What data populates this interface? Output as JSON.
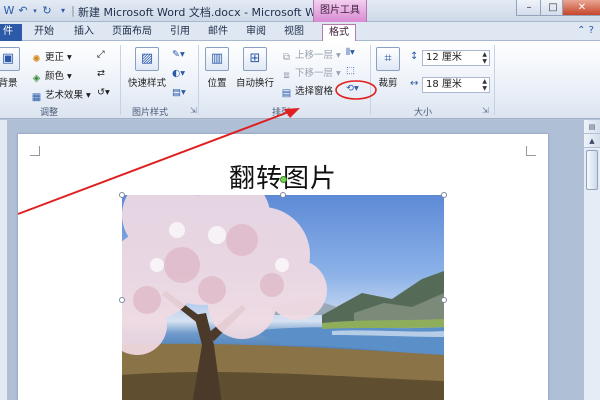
{
  "titlebar": {
    "title": "新建 Microsoft Word 文档.docx - Microsoft W...",
    "context_tab_group": "图片工具",
    "minimize": "–",
    "restore": "□",
    "close": "✕"
  },
  "tabs": {
    "file": "件",
    "home": "开始",
    "insert": "插入",
    "page_layout": "页面布局",
    "references": "引用",
    "mailings": "邮件",
    "review": "审阅",
    "view": "视图",
    "format": "格式"
  },
  "ribbon": {
    "adjust": {
      "remove_bg": "背景",
      "corrections": "更正",
      "color": "颜色",
      "artistic": "艺术效果",
      "label": "调整"
    },
    "picture_styles": {
      "quick_styles": "快速样式",
      "label": "图片样式"
    },
    "arrange": {
      "position": "位置",
      "wrap_text": "自动换行",
      "bring_forward": "上移一层",
      "send_backward": "下移一层",
      "selection_pane": "选择窗格",
      "label": "排列"
    },
    "size": {
      "crop": "裁剪",
      "height": "12 厘米",
      "width": "18 厘米",
      "label": "大小"
    }
  },
  "document": {
    "heading": "翻转图片"
  },
  "colors": {
    "annotation_red": "#e02020",
    "file_tab": "#2c5aa8",
    "context_tab": "#d98ad3"
  }
}
